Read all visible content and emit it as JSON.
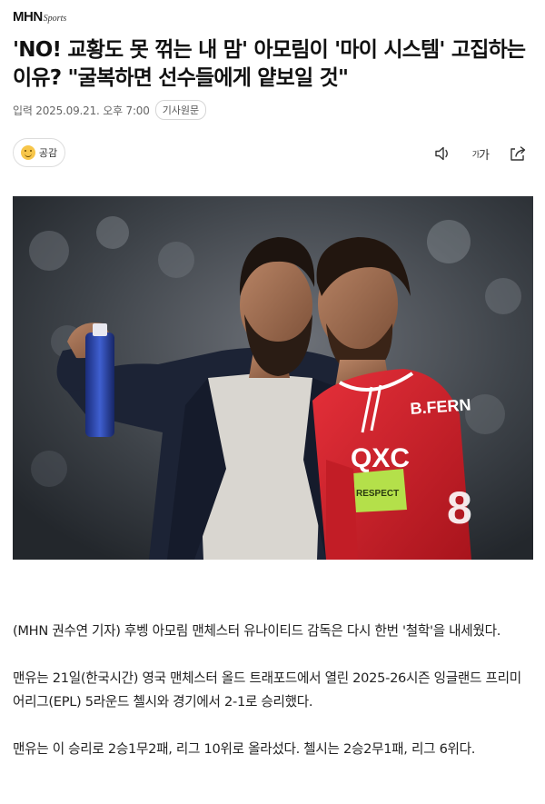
{
  "header": {
    "logo_main": "MHN",
    "logo_sub": "Sports"
  },
  "article": {
    "title": "'NO! 교황도 못 꺾는 내 맘' 아모림이 '마이 시스템' 고집하는 이유? \"굴복하면 선수들에게 얕보일 것\"",
    "date": "입력 2025.09.21. 오후 7:00",
    "source_button": "기사원문",
    "empathy_label": "공감",
    "font_size_label": "가",
    "font_size_small": "가",
    "icons": {
      "empathy": "smile-emoji-icon",
      "audio": "speaker-icon",
      "font": "font-size-icon",
      "share": "share-icon"
    },
    "paragraphs": [
      "(MHN 권수연 기자) 후벵 아모림 맨체스터 유나이티드 감독은 다시 한번 '철학'을 내세웠다.",
      "맨유는 21일(한국시간) 영국 맨체스터 올드 트래포드에서 열린 2025-26시즌 잉글랜드 프리미어리그(EPL) 5라운드 첼시와 경기에서 2-1로 승리했다.",
      "맨유는 이 승리로 2승1무2패, 리그 10위로 올라섰다. 첼시는 2승2무1패, 리그 6위다."
    ],
    "photo": {
      "jersey_name": "B.FERN",
      "sponsor": "QXC",
      "armband": "RESPECT"
    }
  },
  "colors": {
    "jersey_red": "#d4202a",
    "armband_green": "#b4e04a",
    "jacket_navy": "#1c2335"
  }
}
